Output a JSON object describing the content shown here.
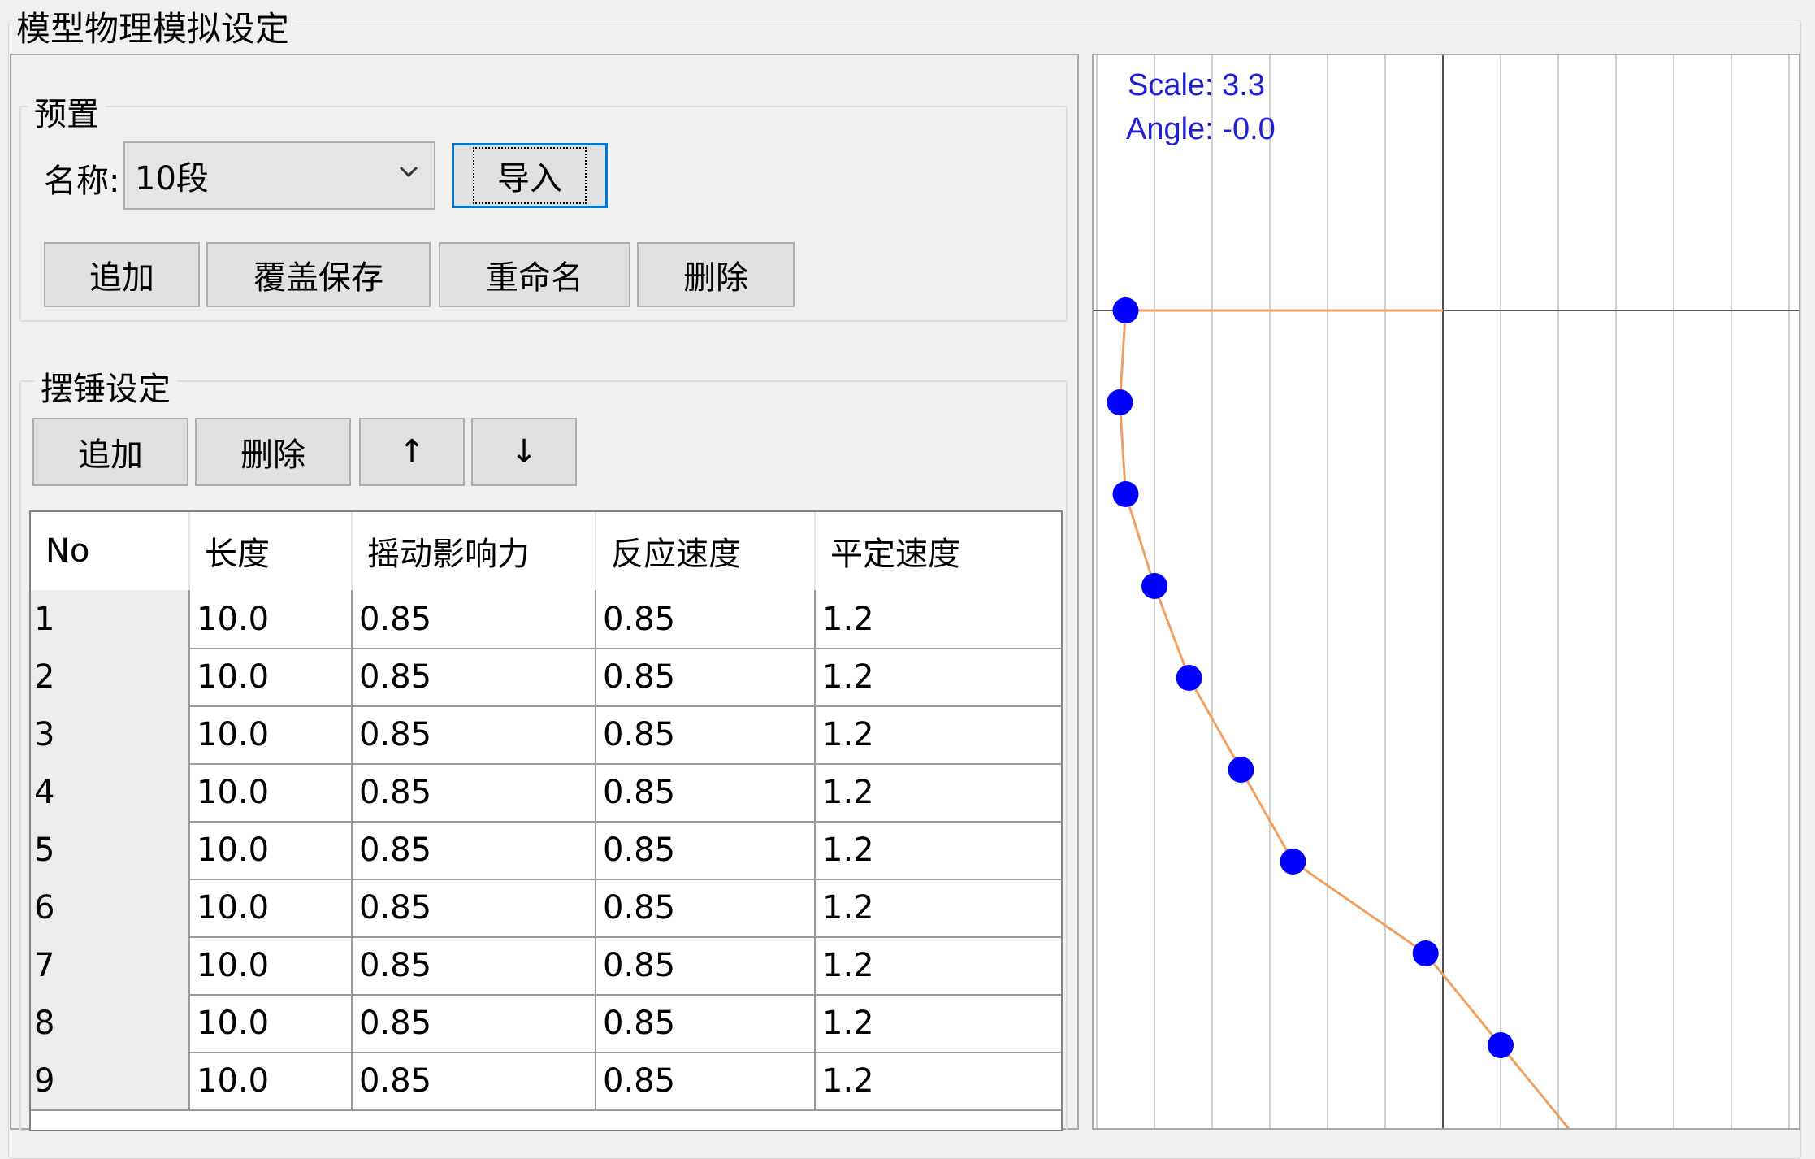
{
  "window": {
    "title": "模型物理模拟设定"
  },
  "preset": {
    "group_title": "预置",
    "name_label": "名称:",
    "name_value": "10段",
    "import_label": "导入",
    "buttons": {
      "add": "追加",
      "overwrite_save": "覆盖保存",
      "rename": "重命名",
      "delete": "删除"
    }
  },
  "pendulum": {
    "group_title": "摆锤设定",
    "buttons": {
      "add": "追加",
      "delete": "删除",
      "up": "↑",
      "down": "↓"
    }
  },
  "table": {
    "headers": [
      "No",
      "长度",
      "摇动影响力",
      "反应速度",
      "平定速度"
    ],
    "rows": [
      [
        "1",
        "10.0",
        "0.85",
        "0.85",
        "1.2"
      ],
      [
        "2",
        "10.0",
        "0.85",
        "0.85",
        "1.2"
      ],
      [
        "3",
        "10.0",
        "0.85",
        "0.85",
        "1.2"
      ],
      [
        "4",
        "10.0",
        "0.85",
        "0.85",
        "1.2"
      ],
      [
        "5",
        "10.0",
        "0.85",
        "0.85",
        "1.2"
      ],
      [
        "6",
        "10.0",
        "0.85",
        "0.85",
        "1.2"
      ],
      [
        "7",
        "10.0",
        "0.85",
        "0.85",
        "1.2"
      ],
      [
        "8",
        "10.0",
        "0.85",
        "0.85",
        "1.2"
      ],
      [
        "9",
        "10.0",
        "0.85",
        "0.85",
        "1.2"
      ]
    ]
  },
  "preview": {
    "scale_text": "Scale: 3.3",
    "angle_text": "Angle: -0.0",
    "colors": {
      "grid": "#d0d0d0",
      "axis": "#555555",
      "chain": "#f0a060",
      "joint": "#0000ff"
    },
    "joint_offsets": [
      -5.5,
      -5.6,
      -5.5,
      -5.0,
      -4.4,
      -3.5,
      -2.6,
      -0.3,
      1.0
    ]
  }
}
